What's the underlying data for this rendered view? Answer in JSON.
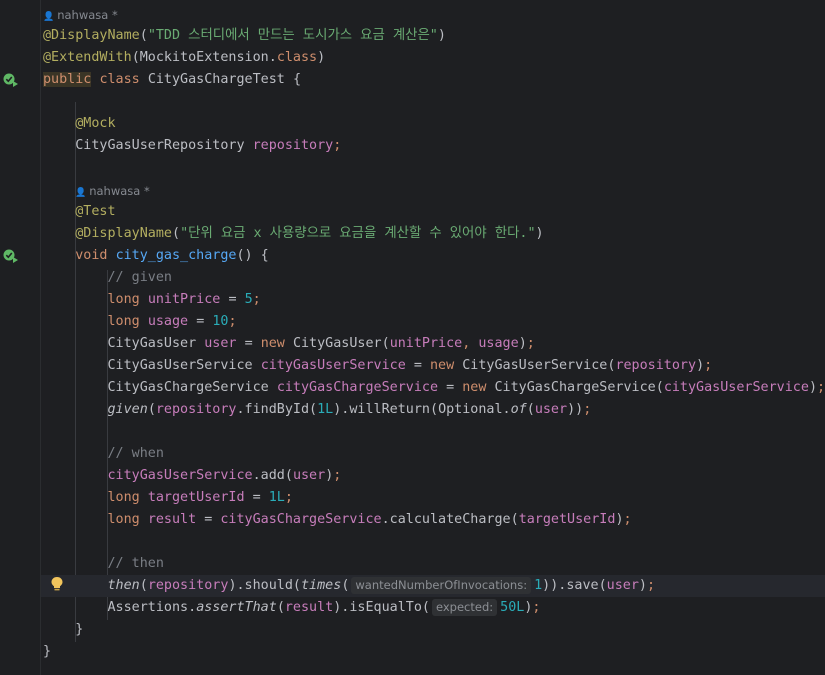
{
  "author": {
    "class_author": "nahwasa *",
    "method_author": "nahwasa *"
  },
  "code": {
    "display_name_class_ann": "@DisplayName",
    "display_name_class_str": "\"TDD 스터디에서 만드는 도시가스 요금 계산은\"",
    "extend_with_ann": "@ExtendWith",
    "extend_with_arg": "MockitoExtension.",
    "extend_with_class_kw": "class",
    "public_kw": "public",
    "class_kw": "class",
    "class_name": "CityGasChargeTest",
    "mock_ann": "@Mock",
    "repo_type": "CityGasUserRepository",
    "repo_field": "repository",
    "test_ann": "@Test",
    "display_name_method_ann": "@DisplayName",
    "display_name_method_str": "\"단위 요금 x 사용량으로 요금을 계산할 수 있어야 한다.\"",
    "void_kw": "void",
    "method_name": "city_gas_charge",
    "comment_given": "// given",
    "long_kw": "long",
    "unit_price_var": "unitPrice",
    "unit_price_val": "5",
    "usage_var": "usage",
    "usage_val": "10",
    "user_type": "CityGasUser",
    "user_var": "user",
    "new_kw": "new",
    "user_service_type": "CityGasUserService",
    "user_service_var": "cityGasUserService",
    "charge_service_type": "CityGasChargeService",
    "charge_service_var": "cityGasChargeService",
    "given_fn": "given",
    "find_by_id": ".findById(",
    "one_l": "1L",
    "will_return": ").willReturn(",
    "optional_of": "Optional.",
    "of_fn": "of",
    "comment_when": "// when",
    "add_call": ".add(",
    "target_user_id_var": "targetUserId",
    "result_var": "result",
    "calc_charge": ".calculateCharge(",
    "comment_then": "// then",
    "then_fn": "then",
    "should_call": ").should(",
    "times_fn": "times",
    "hint_wanted": "wantedNumberOfInvocations:",
    "one": "1",
    "save_call": ")).save(",
    "assertions": "Assertions.",
    "assert_that_fn": "assertThat",
    "is_equal_to": ").isEqualTo(",
    "hint_expected": "expected:",
    "fifty_l": "50L"
  },
  "colors": {
    "background": "#1e1f22",
    "keyword": "#cf8e6d",
    "annotation": "#b3ae60",
    "string": "#6aab73",
    "number": "#2aacb8",
    "field": "#c77dbb",
    "function": "#56a8f5",
    "comment": "#7a7e85"
  },
  "icons": {
    "run_class": "run-test-icon",
    "run_method": "run-test-icon",
    "intention": "lightbulb-icon"
  }
}
